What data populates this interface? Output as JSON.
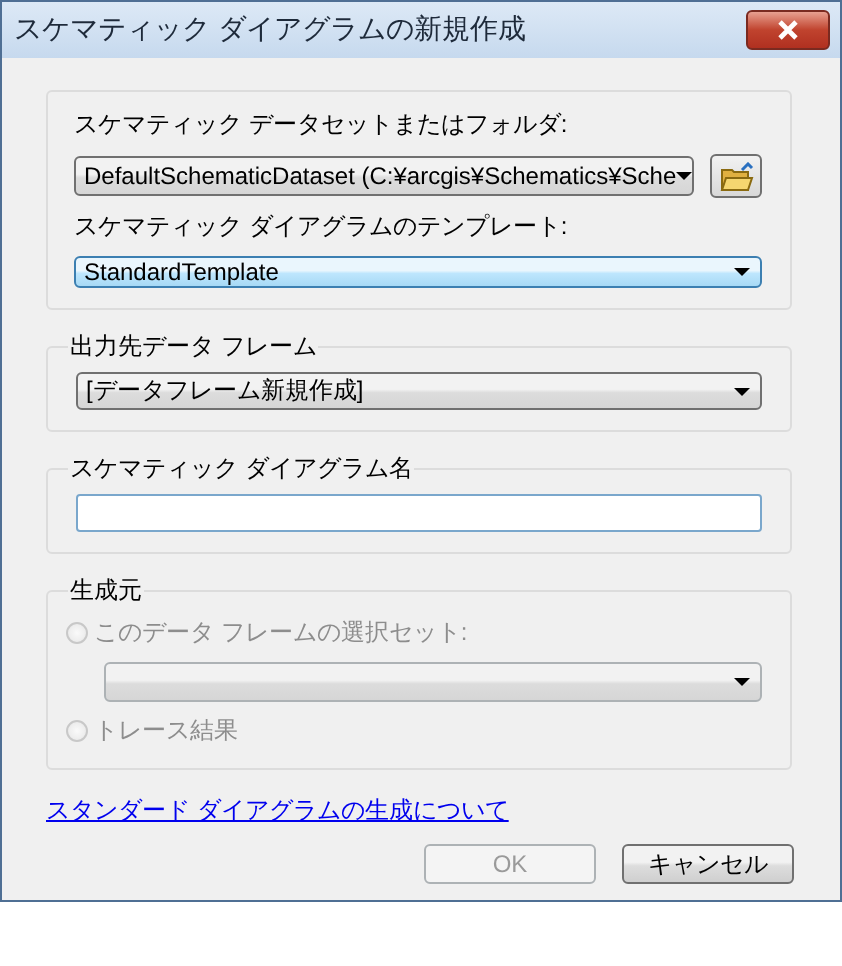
{
  "window": {
    "title": "スケマティック ダイアグラムの新規作成"
  },
  "dataset": {
    "label": "スケマティック データセットまたはフォルダ:",
    "value": "DefaultSchematicDataset (C:¥arcgis¥Schematics¥Sche"
  },
  "template": {
    "label": "スケマティック ダイアグラムのテンプレート:",
    "value": "StandardTemplate",
    "focused": true
  },
  "data_frame": {
    "label": "出力先データ フレーム",
    "value": "[データフレーム新規作成]"
  },
  "diagram_name": {
    "label": "スケマティック ダイアグラム名"
  },
  "source": {
    "label": "生成元",
    "selection_combo": {
      "disabled": true
    },
    "options": [
      {
        "label": "このデータ フレームの選択セット:",
        "selected": false,
        "disabled": true
      },
      {
        "label": "トレース結果",
        "selected": false,
        "disabled": true
      }
    ]
  },
  "link": "スタンダード ダイアグラムの生成について",
  "buttons": [
    {
      "label": "OK",
      "disabled": true
    },
    {
      "label": "キャンセル",
      "disabled": false
    }
  ]
}
